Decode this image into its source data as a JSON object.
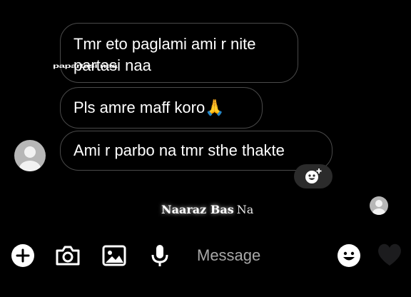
{
  "messages": [
    {
      "line1": "Tmr eto paglami ami r nite",
      "line2": "partasi naa",
      "stray": "papartasi naa"
    },
    {
      "text": "Pls amre maff koro🙏"
    },
    {
      "text": "Ami r parbo na tmr sthe thakte"
    }
  ],
  "caption": {
    "bold": "Naaraz Bas",
    "rest": "Na"
  },
  "composer": {
    "placeholder": "Message"
  },
  "icons": {
    "add": "plus-circle-icon",
    "camera": "camera-icon",
    "gallery": "image-icon",
    "mic": "microphone-icon",
    "sticker": "smiley-icon",
    "like": "heart-icon",
    "react": "add-reaction-icon"
  },
  "colors": {
    "background": "#000000",
    "bubble_border": "#4a4a4a",
    "reaction_bg": "#2b2b2b",
    "avatar": "#b7b7b7"
  }
}
